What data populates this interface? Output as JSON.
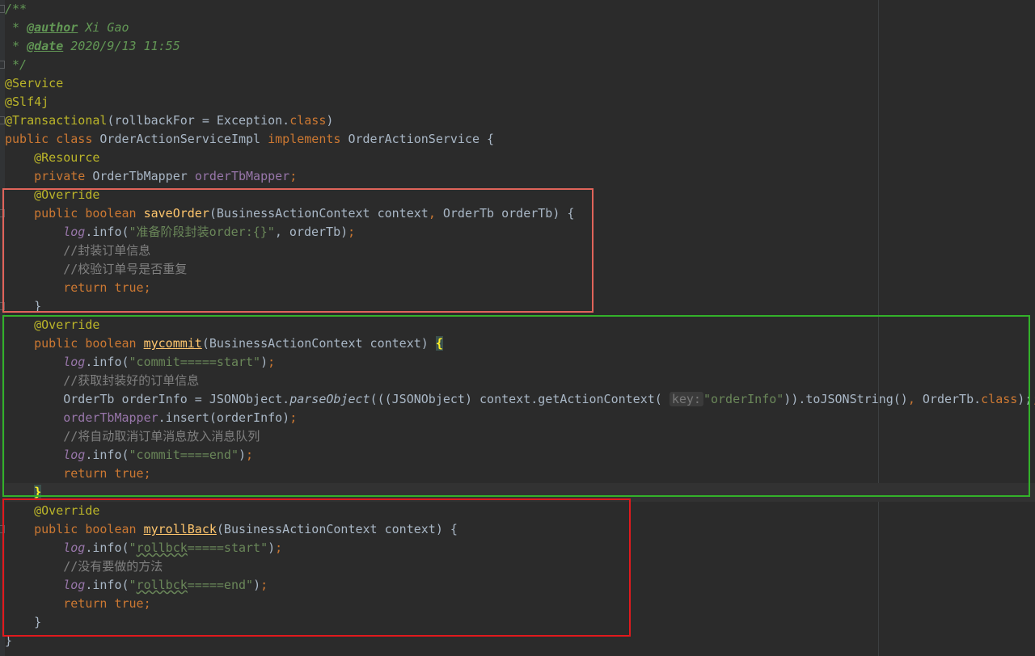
{
  "doc": {
    "open": "/**",
    "star": " * ",
    "author_tag": "@author",
    "author_value": " Xi Gao",
    "date_tag": "@date",
    "date_value": " 2020/9/13 11:55",
    "close": " */"
  },
  "annotations": {
    "service": "@Service",
    "slf4j": "@Slf4j",
    "transactional": "@Transactional",
    "transactional_args_start": "(rollbackFor = Exception.",
    "class_kw": "class",
    "close_paren": ")",
    "resource": "@Resource",
    "override": "@Override"
  },
  "class_decl": {
    "public": "public",
    "class": "class",
    "name": "OrderActionServiceImpl",
    "implements": "implements",
    "interface": "OrderActionService {"
  },
  "field_decl": {
    "private": "private",
    "type": "OrderTbMapper",
    "name": "orderTbMapper",
    "semi": ";"
  },
  "save_method": {
    "public": "public",
    "boolean": "boolean",
    "name": "saveOrder",
    "params_a": "(BusinessActionContext context",
    "comma": ",",
    "params_b": " OrderTb orderTb) {",
    "log": "log",
    "info": ".info(",
    "log_str": "\"准备阶段封装order:{}\"",
    "log_rest": ", orderTb)",
    "comment1": "//封装订单信息",
    "comment2": "//校验订单号是否重复",
    "return": "return",
    "true": "true",
    "close": "}"
  },
  "commit_method": {
    "public": "public",
    "boolean": "boolean",
    "name": "mycommit",
    "params": "(BusinessActionContext context) ",
    "open_brace": "{",
    "log": "log",
    "info": ".info(",
    "log_start_str": "\"commit=====start\"",
    "log_end_paren": ")",
    "comment1": "//获取封装好的订单信息",
    "assign_a": "OrderTb orderInfo = JSONObject.",
    "parse": "parseObject",
    "assign_b": "(((JSONObject) context.getActionContext(",
    "hint_key": "key:",
    "key_str": "\"orderInfo\"",
    "assign_c": ")).toJSONString()",
    "assign_d": " OrderTb.",
    "class_kw": "class",
    "assign_e": ");",
    "mapper": "orderTbMapper",
    "insert": ".insert(orderInfo)",
    "comment2": "//将自动取消订单消息放入消息队列",
    "log_end_str": "\"commit====end\"",
    "return": "return",
    "true": "true",
    "close": "}"
  },
  "rollback_method": {
    "public": "public",
    "boolean": "boolean",
    "name": "myrollBack",
    "params": "(BusinessActionContext context) {",
    "log": "log",
    "info": ".info(",
    "q": "\"",
    "typo_word": "rollbck",
    "start_rest": "=====start\"",
    "end_rest": "=====end\"",
    "close_paren": ")",
    "comment1": "//没有要做的方法",
    "return": "return",
    "true": "true",
    "close": "}"
  },
  "class_close": "}",
  "semi": ";",
  "colors": {
    "background": "#2b2b2b",
    "keyword": "#cc7832",
    "annotation": "#bbb529",
    "string": "#6a8759",
    "comment": "#808080",
    "field": "#9876aa",
    "method": "#ffc66d",
    "box_save": "#e0645a",
    "box_commit": "#33b12a",
    "box_rollback": "#e1191d"
  }
}
